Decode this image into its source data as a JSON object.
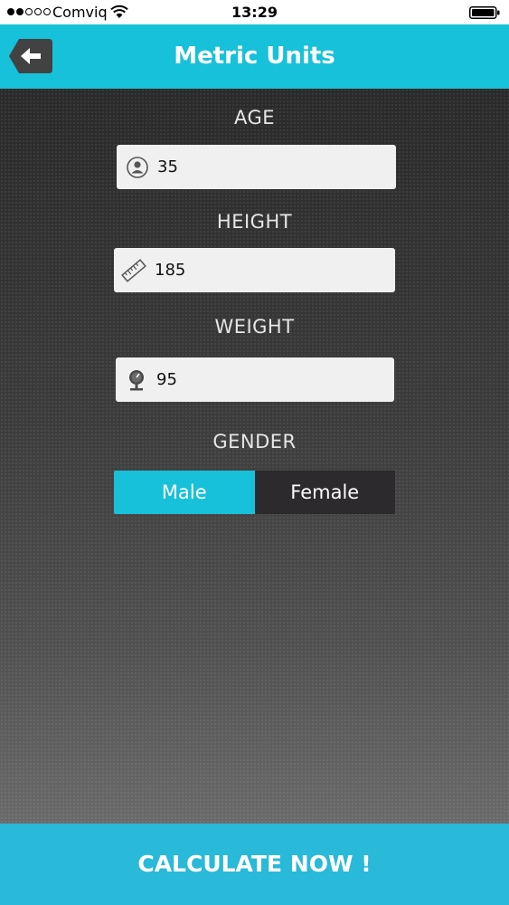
{
  "status_bar": {
    "carrier": "Comviq",
    "time": "13:29"
  },
  "header": {
    "title": "Metric Units",
    "back_icon": "arrow-left-icon"
  },
  "form": {
    "age": {
      "label": "AGE",
      "value": "35",
      "icon": "person-icon"
    },
    "height": {
      "label": "HEIGHT",
      "value": "185",
      "icon": "ruler-icon"
    },
    "weight": {
      "label": "WEIGHT",
      "value": "95",
      "icon": "scale-icon"
    },
    "gender": {
      "label": "GENDER",
      "options": [
        "Male",
        "Female"
      ],
      "selected": "Male"
    }
  },
  "calculate_label": "CALCULATE NOW !",
  "colors": {
    "accent": "#17c1d9",
    "button": "#29b9d9",
    "background": "#333333",
    "input_bg": "#f0f0f0"
  }
}
